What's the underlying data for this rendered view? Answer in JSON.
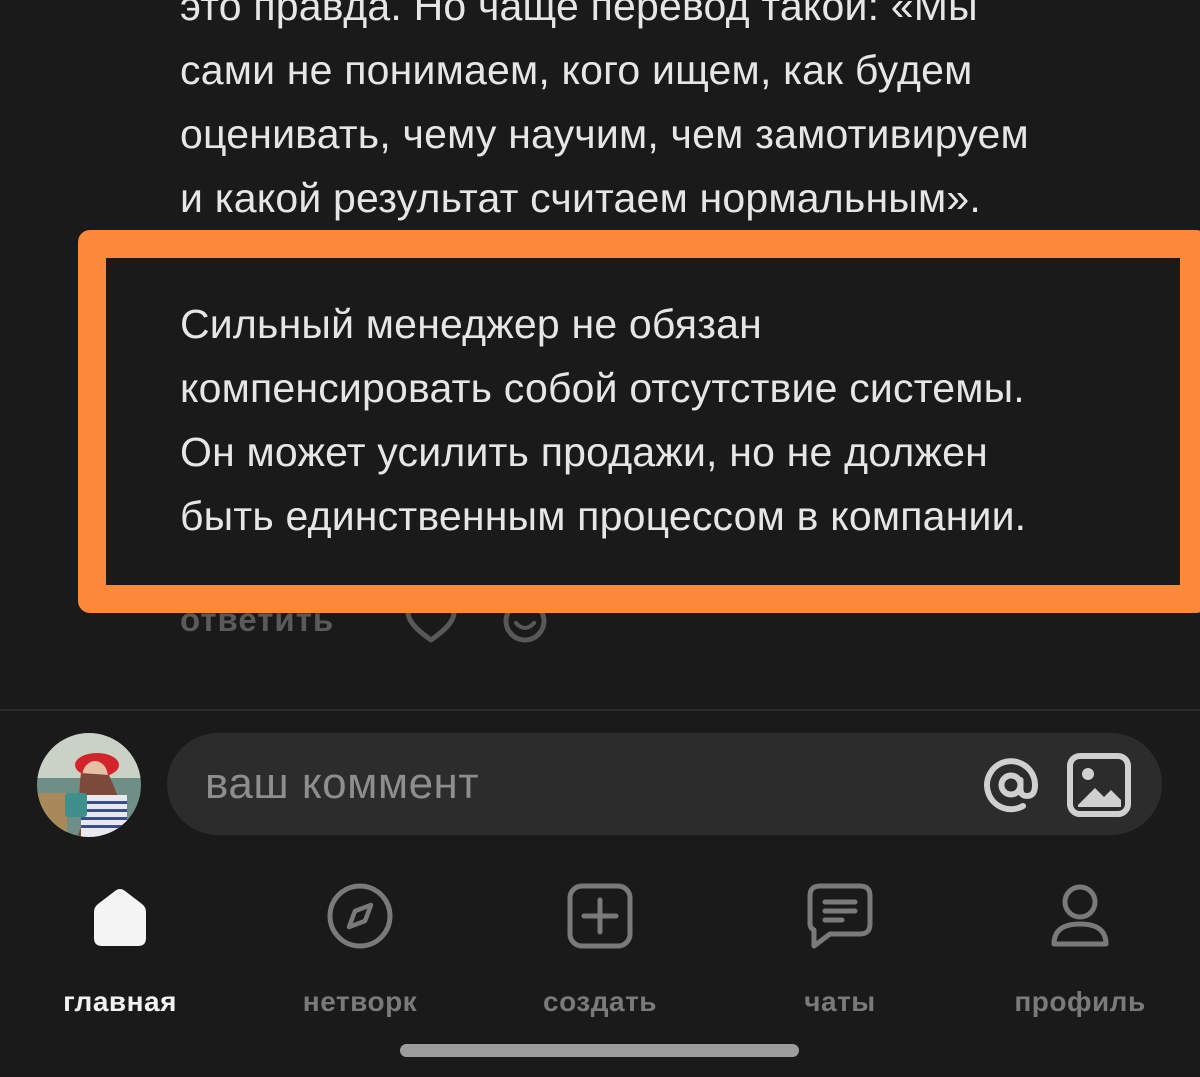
{
  "comment": {
    "paragraph_1": "это правда. Но чаще перевод такой: «Мы\nсами не понимаем, кого ищем, как будем\nоценивать, чему научим, чем замотивируем\nи какой результат считаем нормальным».",
    "paragraph_2": "Сильный менеджер не обязан\nкомпенсировать собой отсутствие системы.\nОн может усилить продажи, но не должен\nбыть единственным процессом в компании."
  },
  "actions": {
    "reply_label": "ответить",
    "like_icon": "heart-icon",
    "react_icon": "smile-icon"
  },
  "composer": {
    "placeholder": "ваш коммент",
    "mention_icon": "at-icon",
    "attach_icon": "image-icon"
  },
  "nav": {
    "items": [
      {
        "label": "главная",
        "icon": "home-icon",
        "active": true
      },
      {
        "label": "нетворк",
        "icon": "compass-icon",
        "active": false
      },
      {
        "label": "создать",
        "icon": "plus-square-icon",
        "active": false
      },
      {
        "label": "чаты",
        "icon": "chat-icon",
        "active": false
      },
      {
        "label": "профиль",
        "icon": "person-icon",
        "active": false
      }
    ]
  },
  "colors": {
    "background": "#1a1a1a",
    "highlight": "#fd8a3a",
    "text": "#e6e6e6",
    "muted": "#7a7a7a"
  }
}
